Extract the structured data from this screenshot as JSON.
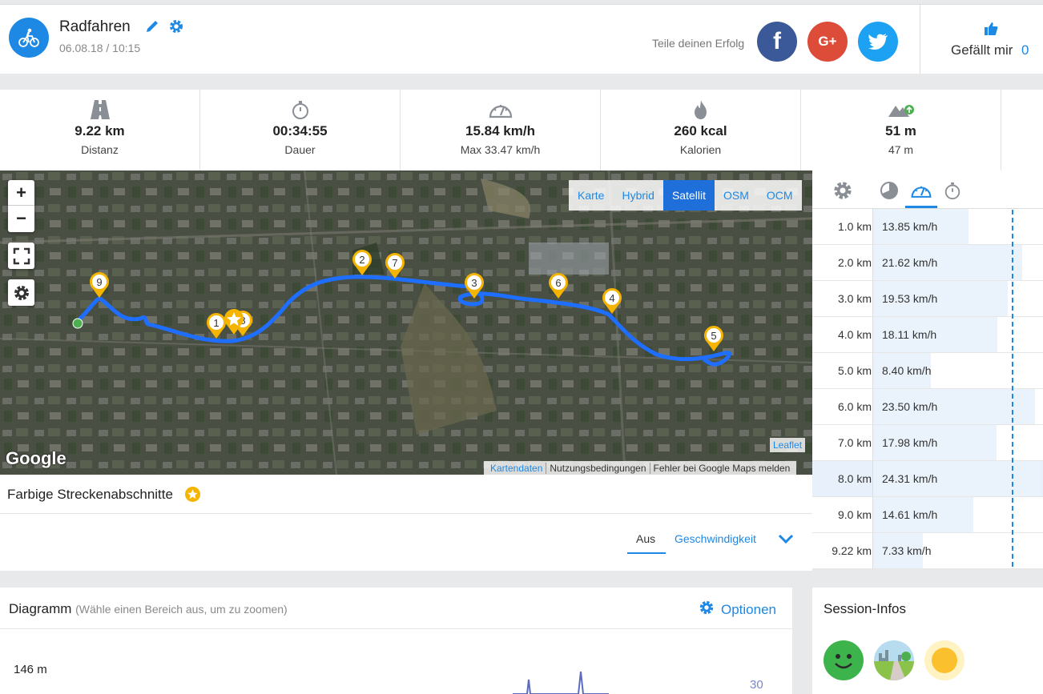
{
  "header": {
    "activity": "Radfahren",
    "datetime": "06.08.18 / 10:15",
    "share_text": "Teile deinen Erfolg",
    "like_label": "Gefällt mir",
    "like_count": "0",
    "colors": {
      "accent": "#1e88e5",
      "facebook": "#3b5998",
      "google": "#dd4b39",
      "twitter": "#1da1f2"
    }
  },
  "stats": [
    {
      "icon": "road-icon",
      "value": "9.22 km",
      "label": "Distanz"
    },
    {
      "icon": "stopwatch-icon",
      "value": "00:34:55",
      "label": "Dauer"
    },
    {
      "icon": "speedometer-icon",
      "value": "15.84 km/h",
      "label": "Max 33.47 km/h"
    },
    {
      "icon": "flame-icon",
      "value": "260 kcal",
      "label": "Kalorien"
    },
    {
      "icon": "elevation-icon",
      "value": "51 m",
      "label": "47 m"
    }
  ],
  "map": {
    "types": [
      "Karte",
      "Hybrid",
      "Satellit",
      "OSM",
      "OCM"
    ],
    "active_type": "Satellit",
    "brand": "Google",
    "leaflet": "Leaflet",
    "attribution": [
      "Kartendaten",
      "Nutzungsbedingungen",
      "Fehler bei Google Maps melden"
    ],
    "markers": [
      "1",
      "2",
      "3",
      "4",
      "5",
      "6",
      "7",
      "8",
      "9"
    ]
  },
  "segments": {
    "title": "Farbige Streckenabschnitte",
    "options": [
      "Aus",
      "Geschwindigkeit"
    ],
    "selected": "Aus"
  },
  "splits": {
    "rows": [
      {
        "km": "1.0 km",
        "speed": "13.85 km/h",
        "value": 13.85
      },
      {
        "km": "2.0 km",
        "speed": "21.62 km/h",
        "value": 21.62
      },
      {
        "km": "3.0 km",
        "speed": "19.53 km/h",
        "value": 19.53
      },
      {
        "km": "4.0 km",
        "speed": "18.11 km/h",
        "value": 18.11
      },
      {
        "km": "5.0 km",
        "speed": "8.40 km/h",
        "value": 8.4
      },
      {
        "km": "6.0 km",
        "speed": "23.50 km/h",
        "value": 23.5
      },
      {
        "km": "7.0 km",
        "speed": "17.98 km/h",
        "value": 17.98
      },
      {
        "km": "8.0 km",
        "speed": "24.31 km/h",
        "value": 24.31
      },
      {
        "km": "9.0 km",
        "speed": "14.61 km/h",
        "value": 14.61
      },
      {
        "km": "9.22 km",
        "speed": "7.33 km/h",
        "value": 7.33
      }
    ],
    "highlighted_row": "8.0 km",
    "max_value": 24.31
  },
  "diagram": {
    "title": "Diagramm",
    "hint": "(Wähle einen Bereich aus, um zu zoomen)",
    "options_label": "Optionen",
    "left_axis_top": "146 m",
    "right_axis_top": "30"
  },
  "session": {
    "title": "Session-Infos",
    "icons": [
      "smiley-icon",
      "trail-icon",
      "sun-icon"
    ]
  }
}
